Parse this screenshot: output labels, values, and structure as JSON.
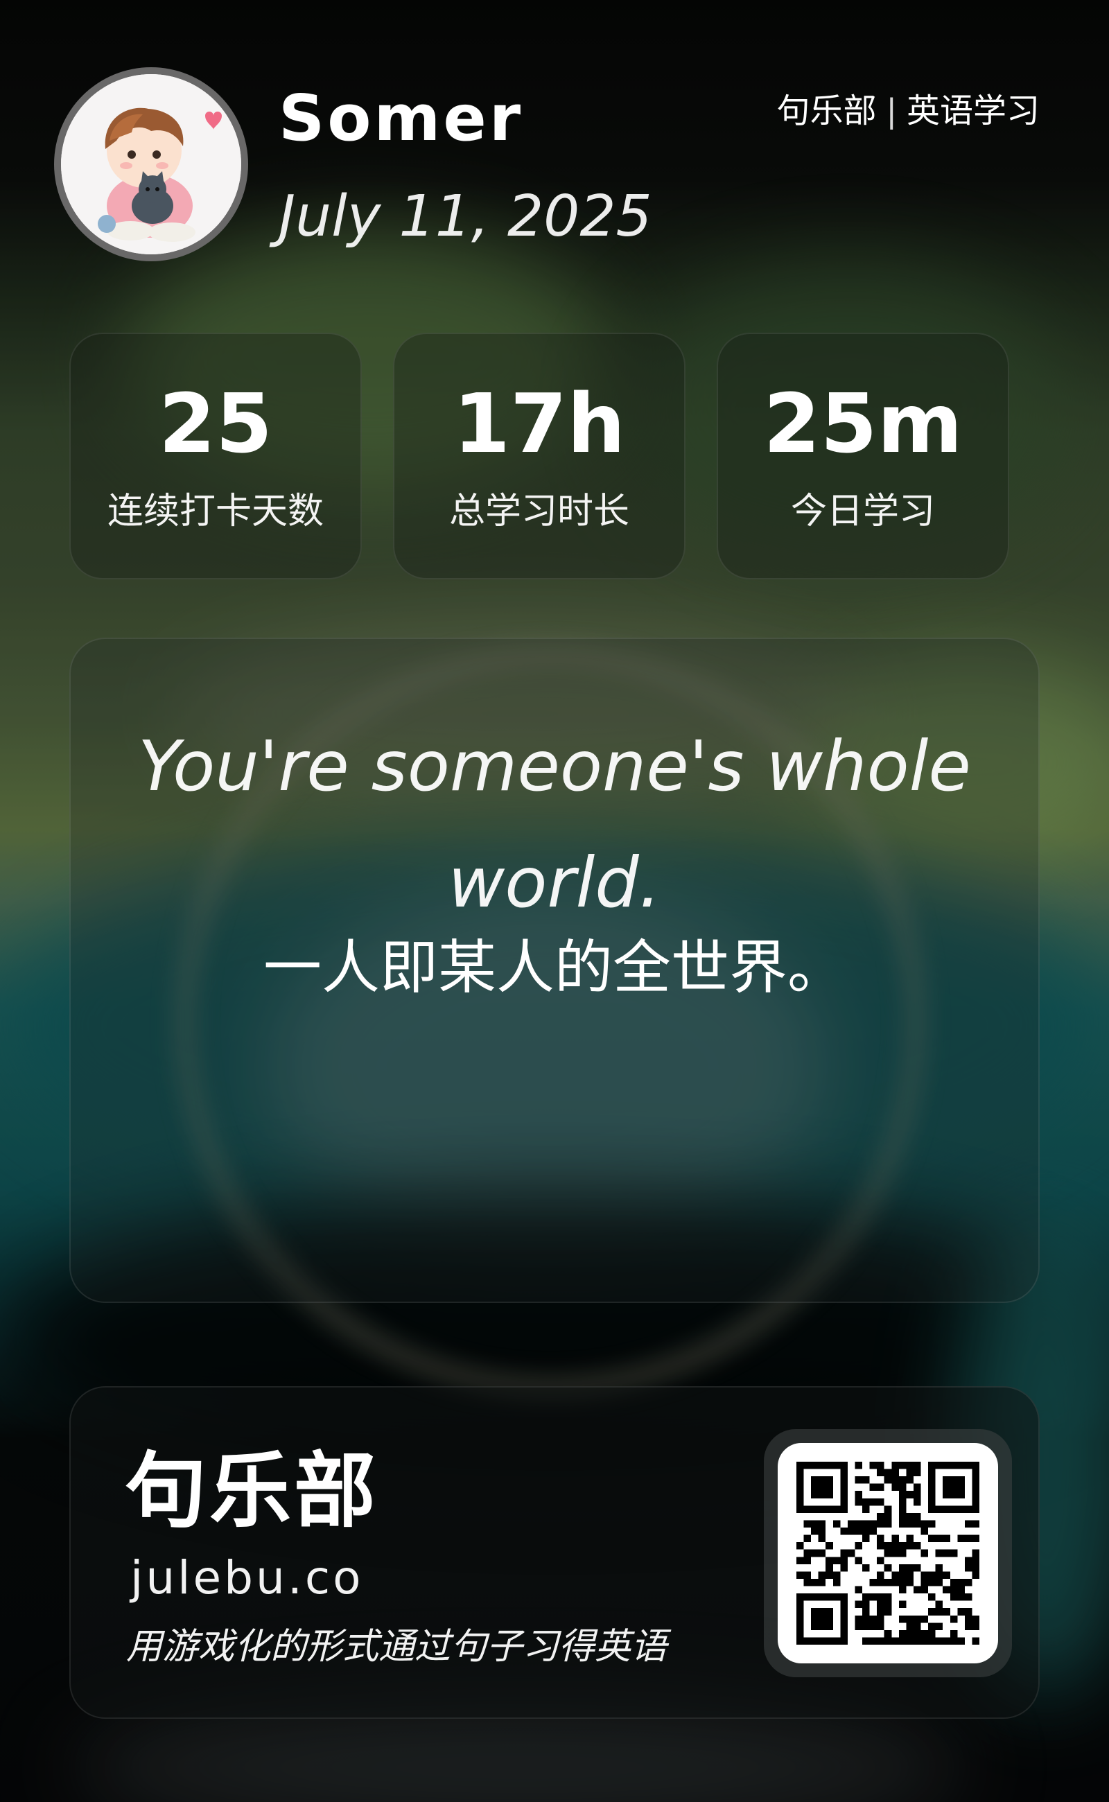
{
  "user": {
    "name": "Somer",
    "date": "July 11, 2025"
  },
  "brand_tag": {
    "left": "句乐部",
    "separator": "|",
    "right": "英语学习"
  },
  "stats": [
    {
      "value": "25",
      "label": "连续打卡天数"
    },
    {
      "value": "17h",
      "label": "总学习时长"
    },
    {
      "value": "25m",
      "label": "今日学习"
    }
  ],
  "quote": {
    "english": "You're someone's whole world.",
    "chinese": "一人即某人的全世界。"
  },
  "footer": {
    "brand_name": "句乐部",
    "url": "julebu.co",
    "tagline": "用游戏化的形式通过句子习得英语"
  },
  "icons": {
    "avatar": "cartoon-boy-with-cat-avatar",
    "qr": "qr-code"
  }
}
